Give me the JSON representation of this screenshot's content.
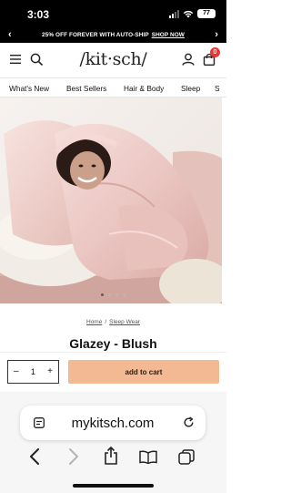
{
  "status": {
    "time": "3:03",
    "battery": "77"
  },
  "promo": {
    "text": "25% OFF FOREVER WITH AUTO-SHIP",
    "link": "SHOP NOW"
  },
  "header": {
    "logo": "/kit·sch/",
    "cart_count": "0"
  },
  "nav": {
    "items": [
      "What's New",
      "Best Sellers",
      "Hair & Body",
      "Sleep",
      "S"
    ]
  },
  "hero": {
    "slide_count": 4,
    "active_slide": 1
  },
  "breadcrumb": {
    "home": "Home",
    "separator": "/",
    "category": "Sleep Wear"
  },
  "product": {
    "title": "Glazey - Blush"
  },
  "buy": {
    "decrement": "–",
    "quantity": "1",
    "increment": "+",
    "add_to_cart": "add to cart"
  },
  "browser": {
    "url": "mykitsch.com"
  },
  "colors": {
    "accent": "#f3b992",
    "badge": "#e53935",
    "banner": "#000000",
    "satin": "#ecc7c4"
  }
}
